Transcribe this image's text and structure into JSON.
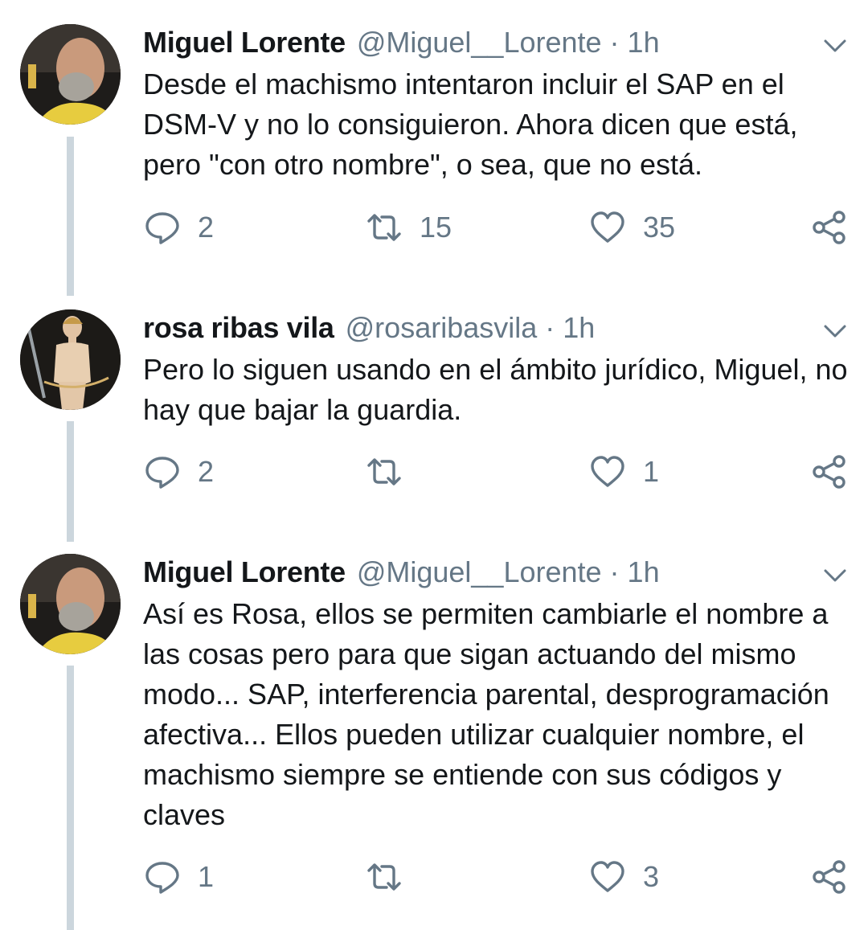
{
  "tweets": [
    {
      "name": "Miguel Lorente",
      "handle": "@Miguel__Lorente",
      "separator": "·",
      "time": "1h",
      "text": "Desde el machismo intentaron incluir el SAP en el DSM-V y no lo consiguieron. Ahora dicen que está, pero \"con otro nombre\", o sea, que no está.",
      "replies": "2",
      "retweets": "15",
      "likes": "35",
      "avatar": "man-avatar"
    },
    {
      "name": "rosa ribas vila",
      "handle": "@rosaribasvila",
      "separator": "·",
      "time": "1h",
      "text": "Pero lo siguen usando en el ámbito jurídico, Miguel, no hay que bajar la guardia.",
      "replies": "2",
      "retweets": "",
      "likes": "1",
      "avatar": "painting-avatar"
    },
    {
      "name": "Miguel Lorente",
      "handle": "@Miguel__Lorente",
      "separator": "·",
      "time": "1h",
      "text": "Así es Rosa, ellos se permiten cambiarle el nombre a las cosas pero para que sigan actuando del mismo modo... SAP, interferencia parental, desprogramación afectiva... Ellos pueden utilizar cualquier nombre, el machismo siempre se entiende con sus códigos y claves",
      "replies": "1",
      "retweets": "",
      "likes": "3",
      "avatar": "man-avatar"
    }
  ],
  "icons": {
    "reply": "reply-icon",
    "retweet": "retweet-icon",
    "like": "heart-icon",
    "share": "share-icon",
    "menu": "chevron-down-icon"
  },
  "colors": {
    "text": "#14171a",
    "secondary": "#657786",
    "thread_line": "#ccd6dd"
  }
}
